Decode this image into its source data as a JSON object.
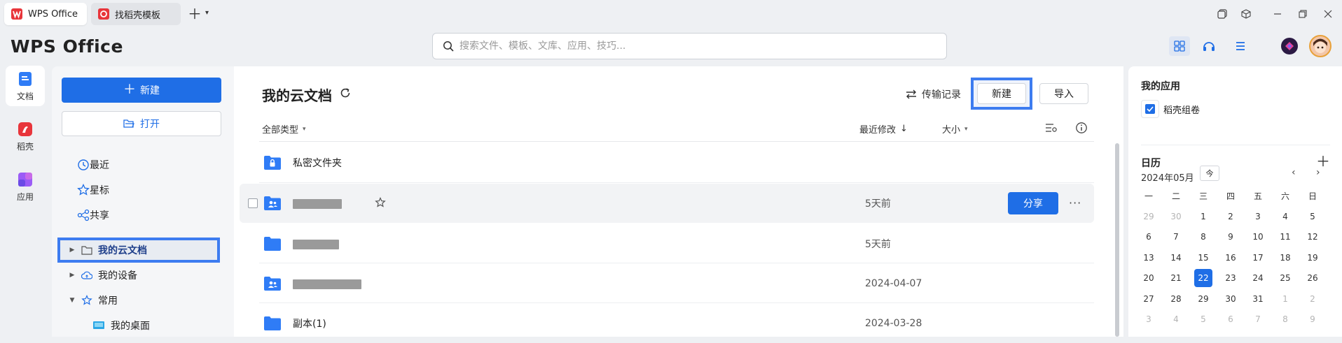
{
  "tabs": [
    {
      "label": "WPS Office",
      "icon": "wps-logo-icon"
    },
    {
      "label": "找稻壳模板",
      "icon": "docer-icon"
    }
  ],
  "app": {
    "logo_text": "WPS Office"
  },
  "search": {
    "placeholder": "搜索文件、模板、文库、应用、技巧..."
  },
  "rail": [
    {
      "label": "文档",
      "icon": "document-icon"
    },
    {
      "label": "稻壳",
      "icon": "docer-icon"
    },
    {
      "label": "应用",
      "icon": "apps-icon"
    }
  ],
  "sidebar": {
    "new_label": "新建",
    "open_label": "打开",
    "nav": [
      {
        "label": "最近",
        "icon": "clock-icon"
      },
      {
        "label": "星标",
        "icon": "star-icon"
      },
      {
        "label": "共享",
        "icon": "share-icon"
      }
    ],
    "tree": [
      {
        "label": "我的云文档",
        "expanded": false,
        "selected": true
      },
      {
        "label": "我的设备",
        "expanded": false
      },
      {
        "label": "常用",
        "expanded": true
      },
      {
        "label": "我的桌面",
        "child": true
      }
    ]
  },
  "main": {
    "title": "我的云文档",
    "transfer_label": "传输记录",
    "new_label": "新建",
    "import_label": "导入",
    "columns": {
      "type": "全部类型",
      "modified": "最近修改",
      "size": "大小"
    },
    "rows": [
      {
        "name": "私密文件夹",
        "date": "",
        "type": "private-folder"
      },
      {
        "name": "",
        "date": "5天前",
        "type": "shared-folder",
        "redacted": true,
        "hovered": true,
        "share_label": "分享"
      },
      {
        "name": "",
        "date": "5天前",
        "type": "folder",
        "redacted": true
      },
      {
        "name": "",
        "date": "2024-04-07",
        "type": "shared-folder",
        "redacted": true
      },
      {
        "name": "副本(1)",
        "date": "2024-03-28",
        "type": "folder"
      }
    ]
  },
  "right": {
    "apps_title": "我的应用",
    "app_item": "稻壳组卷",
    "calendar_title": "日历",
    "month_label": "2024年05月",
    "today_button": "今",
    "weekdays": [
      "一",
      "二",
      "三",
      "四",
      "五",
      "六",
      "日"
    ],
    "days": [
      [
        {
          "d": "29",
          "dim": true
        },
        {
          "d": "30",
          "dim": true
        },
        {
          "d": "1"
        },
        {
          "d": "2"
        },
        {
          "d": "3"
        },
        {
          "d": "4"
        },
        {
          "d": "5"
        }
      ],
      [
        {
          "d": "6"
        },
        {
          "d": "7"
        },
        {
          "d": "8"
        },
        {
          "d": "9"
        },
        {
          "d": "10"
        },
        {
          "d": "11"
        },
        {
          "d": "12"
        }
      ],
      [
        {
          "d": "13"
        },
        {
          "d": "14"
        },
        {
          "d": "15"
        },
        {
          "d": "16"
        },
        {
          "d": "17"
        },
        {
          "d": "18"
        },
        {
          "d": "19"
        }
      ],
      [
        {
          "d": "20"
        },
        {
          "d": "21"
        },
        {
          "d": "22",
          "today": true
        },
        {
          "d": "23"
        },
        {
          "d": "24"
        },
        {
          "d": "25"
        },
        {
          "d": "26"
        }
      ],
      [
        {
          "d": "27"
        },
        {
          "d": "28"
        },
        {
          "d": "29"
        },
        {
          "d": "30"
        },
        {
          "d": "31"
        },
        {
          "d": "1",
          "dim": true
        },
        {
          "d": "2",
          "dim": true
        }
      ],
      [
        {
          "d": "3",
          "dim": true
        },
        {
          "d": "4",
          "dim": true
        },
        {
          "d": "5",
          "dim": true
        },
        {
          "d": "6",
          "dim": true
        },
        {
          "d": "7",
          "dim": true
        },
        {
          "d": "8",
          "dim": true
        },
        {
          "d": "9",
          "dim": true
        }
      ]
    ]
  },
  "colors": {
    "accent": "#1f6ee6",
    "highlight_border": "#3d7cf0",
    "folder": "#2f7cf6"
  }
}
